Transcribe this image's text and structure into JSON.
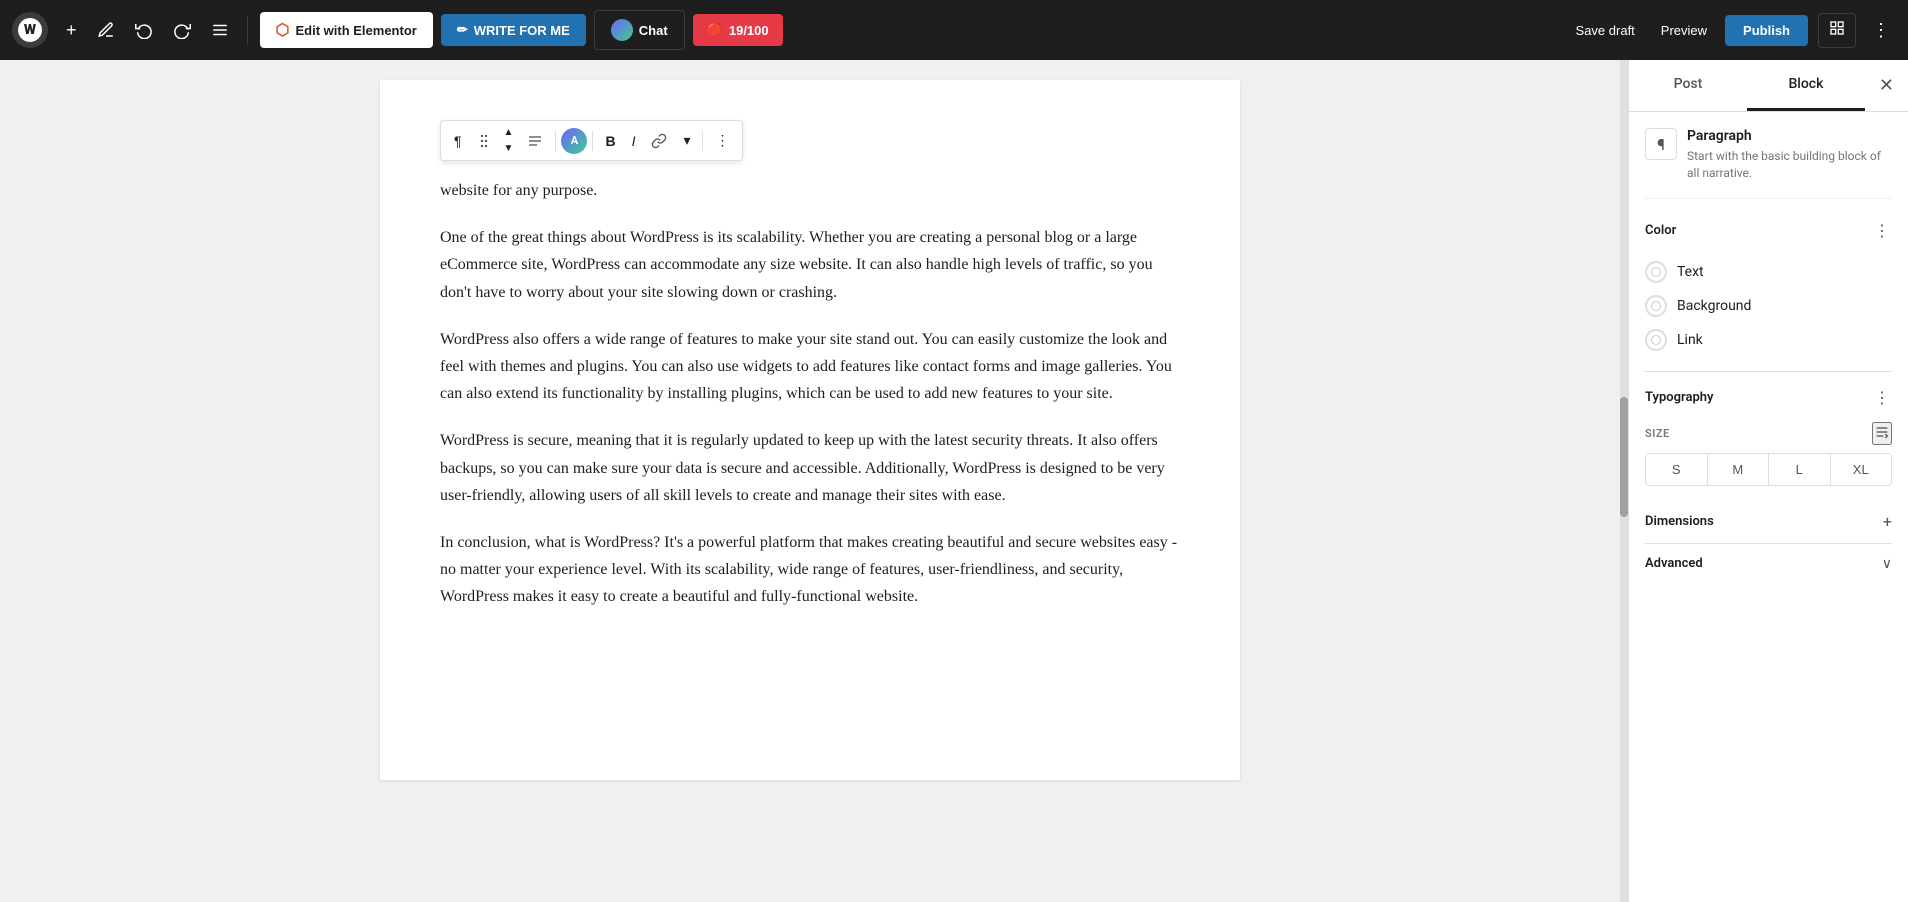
{
  "topbar": {
    "wp_logo": "W",
    "add_btn": "+",
    "edit_tool_btn": "✏",
    "undo_btn": "↩",
    "redo_btn": "↪",
    "list_view_btn": "≡",
    "elementor_label": "Edit with Elementor",
    "write_for_me_label": "WRITE FOR ME",
    "chat_label": "Chat",
    "ai_score_label": "19/100",
    "save_draft_label": "Save draft",
    "preview_label": "Preview",
    "publish_label": "Publish",
    "view_toggle": "⬜",
    "more_options": "⋮"
  },
  "toolbar": {
    "paragraph_icon": "¶",
    "drag_icon": "⠿",
    "up_icon": "▲",
    "down_icon": "▼",
    "align_icon": "≡",
    "avatar_label": "A",
    "bold_label": "B",
    "italic_label": "I",
    "link_label": "🔗",
    "dropdown_label": "▾",
    "more_label": "⋮"
  },
  "content": {
    "para0": "website for any purpose.",
    "para1": "One of the great things about WordPress is its scalability. Whether you are creating a personal blog or a large eCommerce site, WordPress can accommodate any size website. It can also handle high levels of traffic, so you don't have to worry about your site slowing down or crashing.",
    "para2": "WordPress also offers a wide range of features to make your site stand out. You can easily customize the look and feel with themes and plugins. You can also use widgets to add features like contact forms and image galleries. You can also extend its functionality by installing plugins, which can be used to add new features to your site.",
    "para3": "WordPress is secure, meaning that it is regularly updated to keep up with the latest security threats. It also offers backups, so you can make sure your data is secure and accessible. Additionally, WordPress is designed to be very user-friendly, allowing users of all skill levels to create and manage their sites with ease.",
    "para4": "In conclusion, what is WordPress? It's a powerful platform that makes creating beautiful and secure websites easy - no matter your experience level. With its scalability, wide range of features, user-friendliness, and security, WordPress makes it easy to create a beautiful and fully-functional website."
  },
  "right_panel": {
    "tab_post": "Post",
    "tab_block": "Block",
    "close_btn": "✕",
    "block_type": {
      "icon": "¶",
      "title": "Paragraph",
      "description": "Start with the basic building block of all narrative."
    },
    "color_section": {
      "title": "Color",
      "more_icon": "⋮",
      "text_label": "Text",
      "background_label": "Background",
      "link_label": "Link"
    },
    "typography_section": {
      "title": "Typography",
      "more_icon": "⋮",
      "size_label": "SIZE",
      "size_adjust_icon": "⇌",
      "sizes": [
        "S",
        "M",
        "L",
        "XL"
      ]
    },
    "dimensions_section": {
      "title": "Dimensions",
      "expand_icon": "+"
    },
    "advanced_section": {
      "title": "Advanced",
      "chevron_icon": "∨"
    }
  }
}
